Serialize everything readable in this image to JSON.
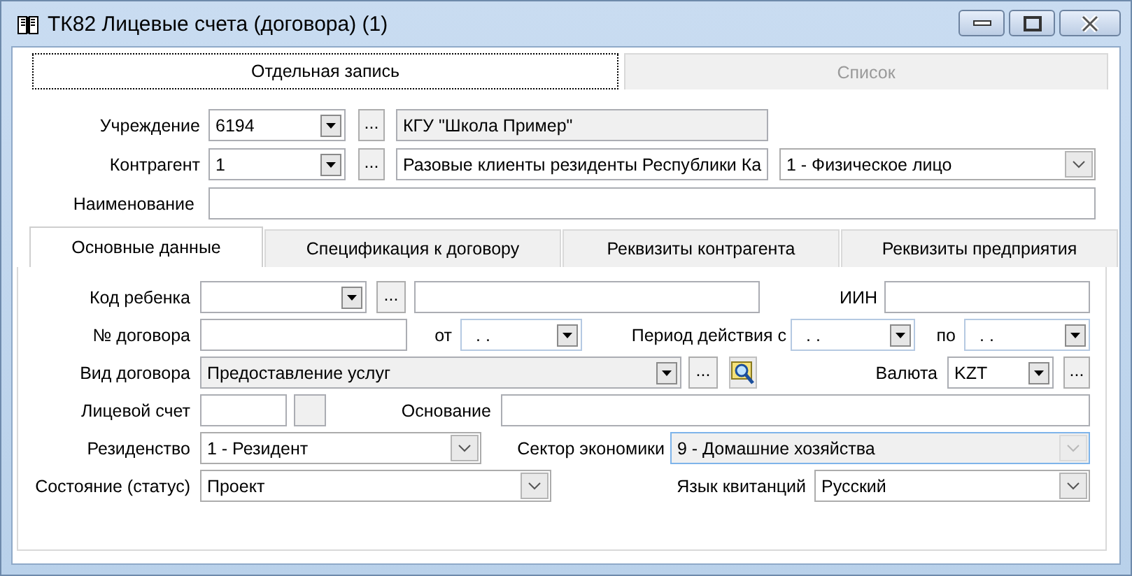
{
  "window": {
    "title": "ТК82 Лицевые счета (договора) (1)"
  },
  "top_tabs": [
    {
      "label": "Отдельная запись",
      "selected": true,
      "disabled": false
    },
    {
      "label": "Список",
      "selected": false,
      "disabled": true
    }
  ],
  "header_rows": [
    [
      {
        "kind": "label",
        "text": "Учреждение"
      },
      {
        "kind": "combo",
        "value": "6194",
        "readonly": false
      },
      {
        "kind": "button",
        "text": "..."
      },
      {
        "kind": "text",
        "value": "КГУ \"Школа Пример\"",
        "readonly": true
      }
    ],
    [
      {
        "kind": "label",
        "text": "Контрагент"
      },
      {
        "kind": "combo",
        "value": "1",
        "readonly": false
      },
      {
        "kind": "button",
        "text": "..."
      },
      {
        "kind": "text",
        "value": "Разовые клиенты резиденты Республики Ка",
        "readonly": false
      },
      {
        "kind": "select",
        "value": "1 - Физическое лицо",
        "disabled": false
      }
    ],
    [
      {
        "kind": "label",
        "text": "Наименование"
      },
      {
        "kind": "text",
        "readonly": false
      }
    ]
  ],
  "inner_tabs": [
    {
      "label": "Основные данные",
      "selected": true
    },
    {
      "label": "Спецификация к договору",
      "selected": false
    },
    {
      "label": "Реквизиты контрагента",
      "selected": false
    },
    {
      "label": "Реквизиты предприятия",
      "selected": false
    }
  ],
  "form_rows": [
    [
      {
        "kind": "label",
        "text": "Код ребенка"
      },
      {
        "kind": "combo",
        "readonly": false
      },
      {
        "kind": "button",
        "text": "..."
      },
      {
        "kind": "text",
        "readonly": false
      },
      {
        "kind": "label",
        "text": "ИИН"
      },
      {
        "kind": "text",
        "readonly": false
      }
    ],
    [
      {
        "kind": "label",
        "text": "№ договора"
      },
      {
        "kind": "text",
        "readonly": false
      },
      {
        "kind": "label",
        "text": "от"
      },
      {
        "kind": "date",
        "value": ". ."
      },
      {
        "kind": "label",
        "text": "Период действия с"
      },
      {
        "kind": "date",
        "value": ". ."
      },
      {
        "kind": "label",
        "text": "по"
      },
      {
        "kind": "date",
        "value": ". ."
      }
    ],
    [
      {
        "kind": "label",
        "text": "Вид договора"
      },
      {
        "kind": "combo",
        "value": "Предоставление услуг",
        "readonly": true
      },
      {
        "kind": "button",
        "text": "..."
      },
      {
        "kind": "lookup"
      },
      {
        "kind": "label",
        "text": "Валюта"
      },
      {
        "kind": "combo",
        "value": "KZT",
        "readonly": false
      },
      {
        "kind": "button",
        "text": "..."
      }
    ],
    [
      {
        "kind": "label",
        "text": "Лицевой счет"
      },
      {
        "kind": "text",
        "readonly": false
      },
      {
        "kind": "text",
        "readonly": true
      },
      {
        "kind": "label",
        "text": "Основание"
      },
      {
        "kind": "text",
        "readonly": false
      }
    ],
    [
      {
        "kind": "label",
        "text": "Резиденство"
      },
      {
        "kind": "select",
        "value": "1 - Резидент",
        "disabled": false
      },
      {
        "kind": "label",
        "text": "Сектор экономики"
      },
      {
        "kind": "select",
        "value": "9 - Домашние хозяйства",
        "disabled": true
      }
    ],
    [
      {
        "kind": "label",
        "text": "Состояние (статус)"
      },
      {
        "kind": "select",
        "value": "Проект",
        "disabled": false
      },
      {
        "kind": "label",
        "text": "Язык квитанций"
      },
      {
        "kind": "select",
        "value": "Русский",
        "disabled": false
      }
    ]
  ]
}
